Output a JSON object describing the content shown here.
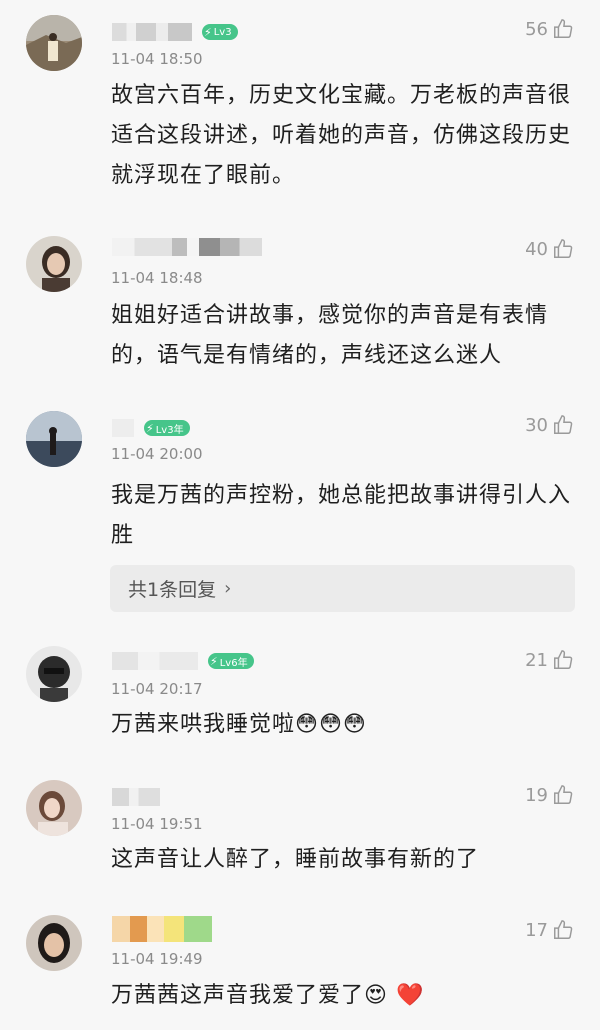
{
  "comments": [
    {
      "badge": "Lv3",
      "time": "11-04 18:50",
      "likes": "56",
      "text": "故宫六百年，历史文化宝藏。万老板的声音很适合这段讲述，听着她的声音，仿佛这段历史就浮现在了眼前。"
    },
    {
      "badge": "",
      "time": "11-04 18:48",
      "likes": "40",
      "text": "姐姐好适合讲故事，感觉你的声音是有表情的，语气是有情绪的，声线还这么迷人"
    },
    {
      "badge": "Lv3年",
      "time": "11-04 20:00",
      "likes": "30",
      "text": "我是万茜的声控粉，她总能把故事讲得引人入胜",
      "reply_label": "共1条回复"
    },
    {
      "badge": "Lv6年",
      "time": "11-04 20:17",
      "likes": "21",
      "text": "万茜来哄我睡觉啦",
      "emoji": "😳😳😳"
    },
    {
      "badge": "",
      "time": "11-04 19:51",
      "likes": "19",
      "text": "这声音让人醉了，睡前故事有新的了"
    },
    {
      "badge": "",
      "time": "11-04 19:49",
      "likes": "17",
      "text": "万茜茜这声音我爱了爱了",
      "emoji": "😍 ❤️"
    }
  ],
  "colors": {
    "badge": "#46c58a",
    "background": "#f7f7f7"
  }
}
